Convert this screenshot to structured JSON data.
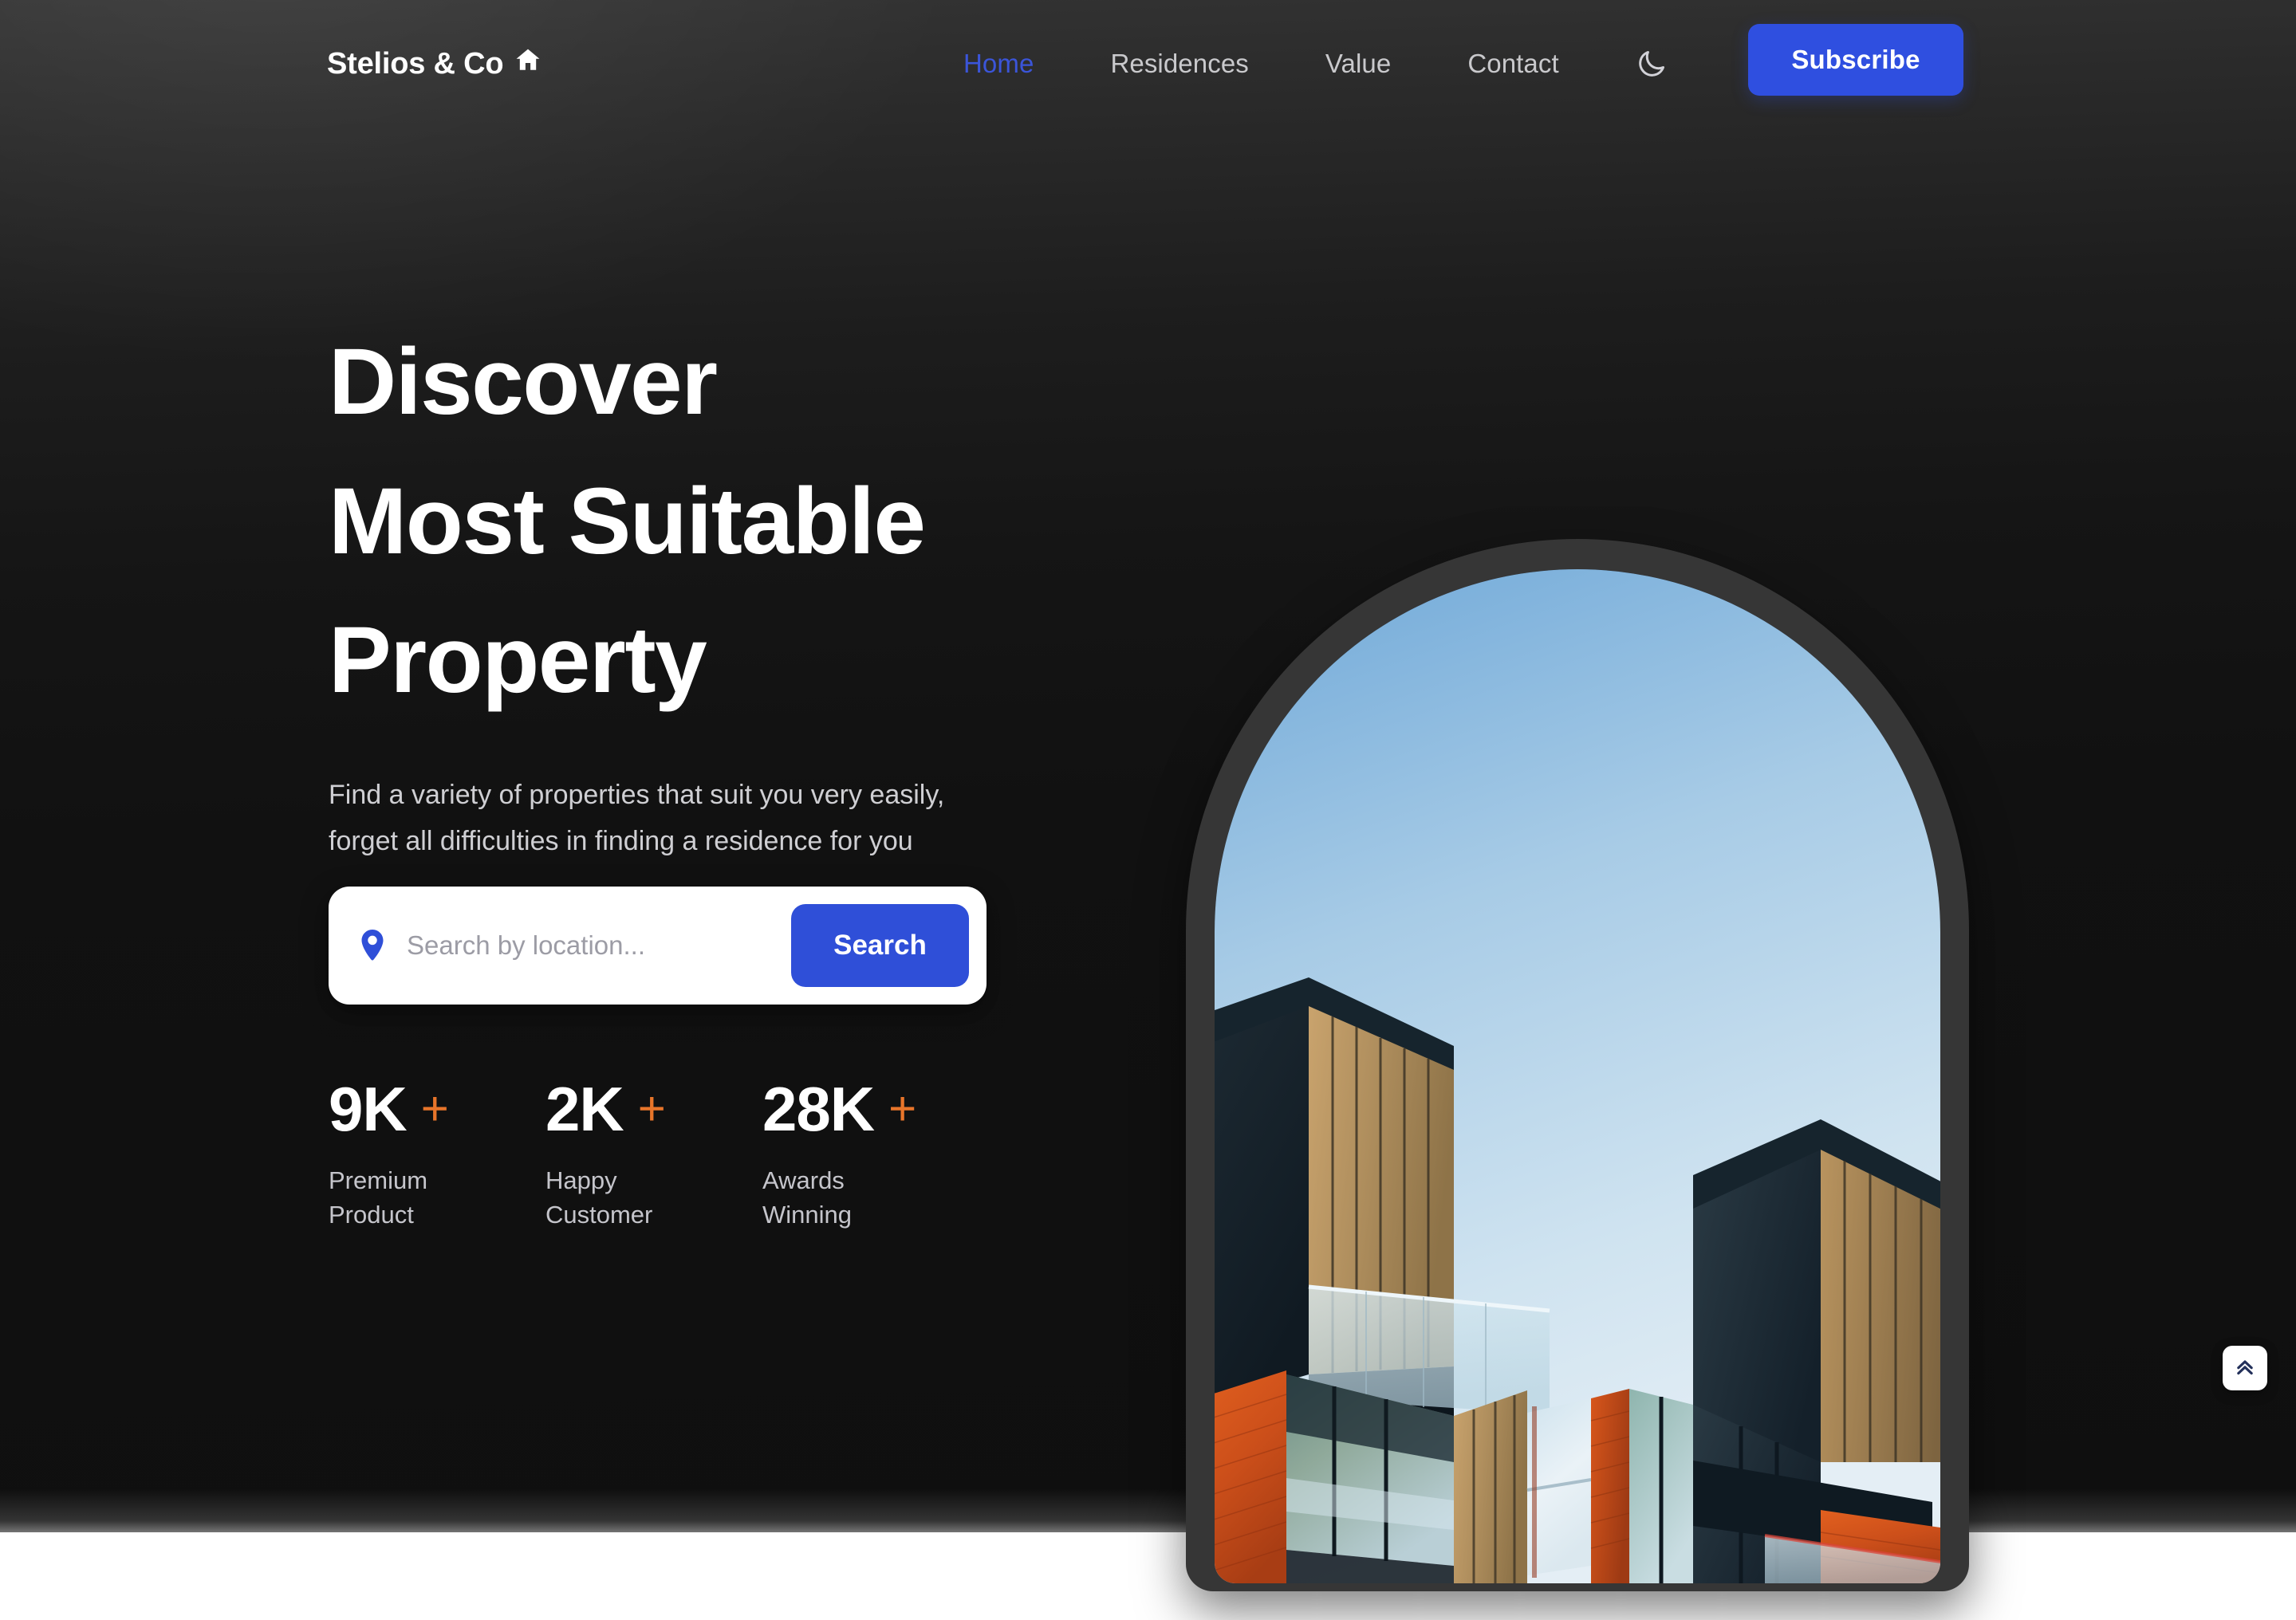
{
  "navbar": {
    "brand": "Stelios & Co",
    "brand_icon": "home-icon",
    "links": [
      {
        "label": "Home",
        "active": true
      },
      {
        "label": "Residences",
        "active": false
      },
      {
        "label": "Value",
        "active": false
      },
      {
        "label": "Contact",
        "active": false
      }
    ],
    "theme_toggle_icon": "moon-icon",
    "subscribe_label": "Subscribe"
  },
  "hero": {
    "headline_lines": [
      "Discover",
      "Most Suitable",
      "Property"
    ],
    "subcopy_lines": [
      "Find a variety of properties that suit you very easily,",
      "forget all difficulties in finding a residence for you"
    ],
    "search": {
      "pin_icon": "map-pin-icon",
      "placeholder": "Search by location...",
      "value": "",
      "button_label": "Search"
    },
    "stats": [
      {
        "value": "9K",
        "plus": "+",
        "label_lines": [
          "Premium",
          "Product"
        ]
      },
      {
        "value": "2K",
        "plus": "+",
        "label_lines": [
          "Happy",
          "Customer"
        ]
      },
      {
        "value": "28K",
        "plus": "+",
        "label_lines": [
          "Awards",
          "Winning"
        ]
      }
    ],
    "image_alt": "modern apartment building with brick and glass balconies against blue sky"
  },
  "scroll_top": {
    "icon": "double-chevron-up-icon"
  },
  "colors": {
    "accent_blue": "#2f4fe0",
    "nav_active_blue": "#3b55d9",
    "accent_orange": "#e8752a",
    "hero_bg_top": "#343434",
    "hero_bg_bottom": "#0f0f0f",
    "arch_frame": "#363636",
    "scroll_top_icon": "#23305a"
  }
}
